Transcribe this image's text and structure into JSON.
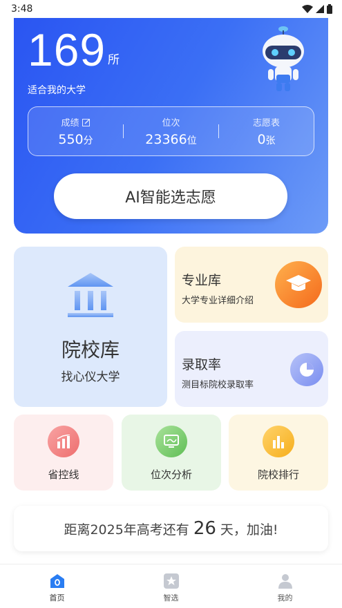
{
  "status_bar": {
    "time": "3:48"
  },
  "hero": {
    "count": "169",
    "count_unit": "所",
    "subtitle": "适合我的大学",
    "stats": [
      {
        "label": "成绩",
        "value": "550",
        "unit": "分"
      },
      {
        "label": "位次",
        "value": "23366",
        "unit": "位"
      },
      {
        "label": "志愿表",
        "value": "0",
        "unit": "张"
      }
    ],
    "ai_button": "AI智能选志愿"
  },
  "library": {
    "title": "院校库",
    "subtitle": "找心仪大学"
  },
  "major": {
    "title": "专业库",
    "subtitle": "大学专业详细介绍"
  },
  "rate": {
    "title": "录取率",
    "subtitle": "测目标院校录取率"
  },
  "tools": [
    {
      "label": "省控线"
    },
    {
      "label": "位次分析"
    },
    {
      "label": "院校排行"
    }
  ],
  "countdown": {
    "prefix": "距离2025年高考还有",
    "days": "26",
    "suffix": "天，加油!"
  },
  "tabs": [
    {
      "label": "首页"
    },
    {
      "label": "智选"
    },
    {
      "label": "我的"
    }
  ],
  "colors": {
    "primary": "#2a55f2",
    "accent_orange": "#f77f1a",
    "accent_purple": "#7a8ef0"
  }
}
